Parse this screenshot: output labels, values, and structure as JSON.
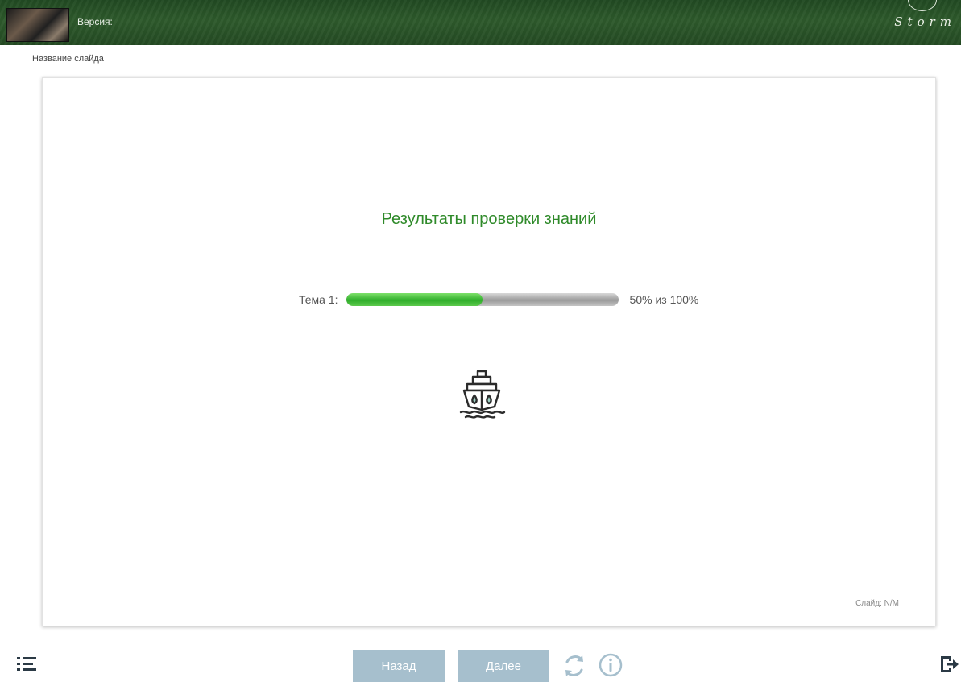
{
  "header": {
    "version_label": "Версия:",
    "brand": "Storm"
  },
  "slide": {
    "name": "Название слайда",
    "title": "Результаты проверки знаний",
    "topics": [
      {
        "label": "Тема 1:",
        "progress_percent": 50,
        "score_text": "50% из 100%"
      }
    ],
    "counter": "Слайд: N/M"
  },
  "navigation": {
    "back_label": "Назад",
    "next_label": "Далее"
  },
  "colors": {
    "header_green": "#2e5a2c",
    "title_green": "#2f8a2a",
    "progress_green": "#2fae2a",
    "button_blue": "#a6bfcd",
    "icon_dark": "#2b3a45"
  },
  "icons": [
    "menu-icon",
    "refresh-icon",
    "info-icon",
    "exit-icon",
    "ship-icon"
  ]
}
